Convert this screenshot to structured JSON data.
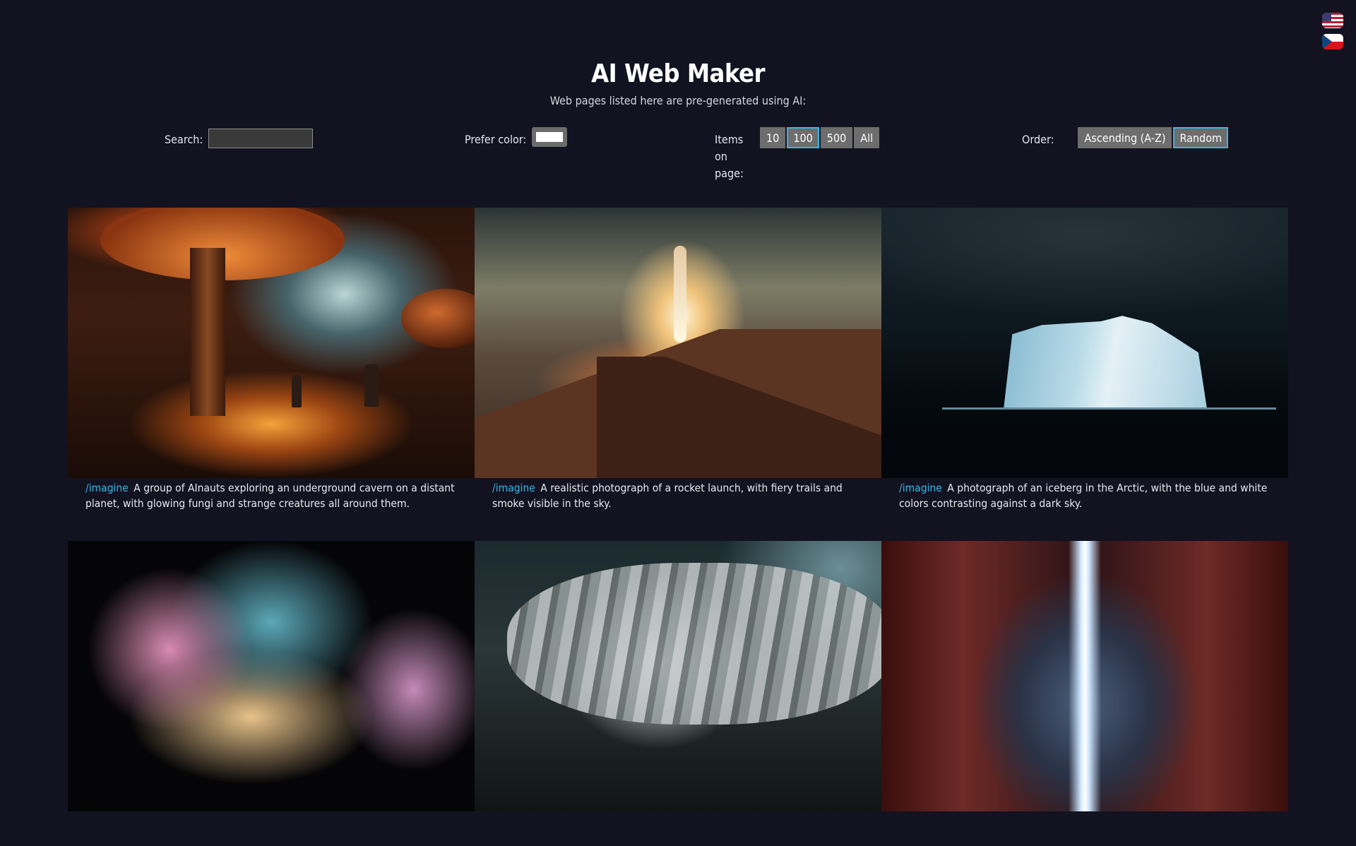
{
  "header": {
    "title": "AI Web Maker",
    "subtitle": "Web pages listed here are pre-generated using AI:"
  },
  "languages": [
    "us-flag-icon",
    "cz-flag-icon"
  ],
  "controls": {
    "search_label": "Search:",
    "search_value": "",
    "color_label": "Prefer color:",
    "color_value": "#ffffff",
    "items_label": "Items on page:",
    "items_options": [
      "10",
      "100",
      "500",
      "All"
    ],
    "items_selected": "100",
    "order_label": "Order:",
    "order_options": [
      "Ascending (A-Z)",
      "Random"
    ],
    "order_selected": "Random"
  },
  "cards": [
    {
      "command": "/imagine",
      "prompt": "A group of AInauts exploring an underground cavern on a distant planet, with glowing fungi and strange creatures all around them."
    },
    {
      "command": "/imagine",
      "prompt": "A realistic photograph of a rocket launch, with fiery trails and smoke visible in the sky."
    },
    {
      "command": "/imagine",
      "prompt": "A photograph of an iceberg in the Arctic, with the blue and white colors contrasting against a dark sky."
    },
    {
      "command": "",
      "prompt": ""
    },
    {
      "command": "",
      "prompt": ""
    },
    {
      "command": "",
      "prompt": ""
    }
  ],
  "colors": {
    "background": "#121221",
    "accent": "#38b6ea",
    "button": "#6d6d6d"
  }
}
